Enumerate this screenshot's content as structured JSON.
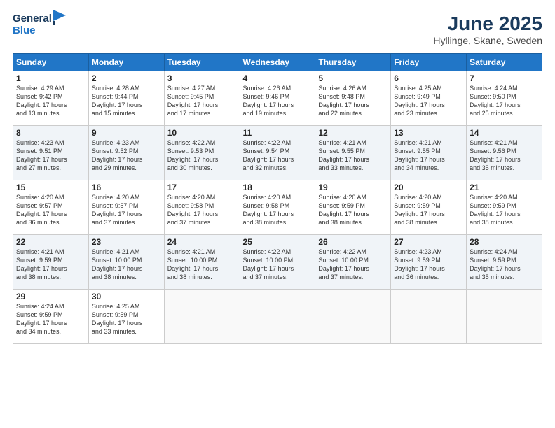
{
  "logo": {
    "general": "General",
    "blue": "Blue"
  },
  "title": "June 2025",
  "location": "Hyllinge, Skane, Sweden",
  "header_days": [
    "Sunday",
    "Monday",
    "Tuesday",
    "Wednesday",
    "Thursday",
    "Friday",
    "Saturday"
  ],
  "weeks": [
    [
      {
        "day": "1",
        "info": "Sunrise: 4:29 AM\nSunset: 9:42 PM\nDaylight: 17 hours\nand 13 minutes."
      },
      {
        "day": "2",
        "info": "Sunrise: 4:28 AM\nSunset: 9:44 PM\nDaylight: 17 hours\nand 15 minutes."
      },
      {
        "day": "3",
        "info": "Sunrise: 4:27 AM\nSunset: 9:45 PM\nDaylight: 17 hours\nand 17 minutes."
      },
      {
        "day": "4",
        "info": "Sunrise: 4:26 AM\nSunset: 9:46 PM\nDaylight: 17 hours\nand 19 minutes."
      },
      {
        "day": "5",
        "info": "Sunrise: 4:26 AM\nSunset: 9:48 PM\nDaylight: 17 hours\nand 22 minutes."
      },
      {
        "day": "6",
        "info": "Sunrise: 4:25 AM\nSunset: 9:49 PM\nDaylight: 17 hours\nand 23 minutes."
      },
      {
        "day": "7",
        "info": "Sunrise: 4:24 AM\nSunset: 9:50 PM\nDaylight: 17 hours\nand 25 minutes."
      }
    ],
    [
      {
        "day": "8",
        "info": "Sunrise: 4:23 AM\nSunset: 9:51 PM\nDaylight: 17 hours\nand 27 minutes."
      },
      {
        "day": "9",
        "info": "Sunrise: 4:23 AM\nSunset: 9:52 PM\nDaylight: 17 hours\nand 29 minutes."
      },
      {
        "day": "10",
        "info": "Sunrise: 4:22 AM\nSunset: 9:53 PM\nDaylight: 17 hours\nand 30 minutes."
      },
      {
        "day": "11",
        "info": "Sunrise: 4:22 AM\nSunset: 9:54 PM\nDaylight: 17 hours\nand 32 minutes."
      },
      {
        "day": "12",
        "info": "Sunrise: 4:21 AM\nSunset: 9:55 PM\nDaylight: 17 hours\nand 33 minutes."
      },
      {
        "day": "13",
        "info": "Sunrise: 4:21 AM\nSunset: 9:55 PM\nDaylight: 17 hours\nand 34 minutes."
      },
      {
        "day": "14",
        "info": "Sunrise: 4:21 AM\nSunset: 9:56 PM\nDaylight: 17 hours\nand 35 minutes."
      }
    ],
    [
      {
        "day": "15",
        "info": "Sunrise: 4:20 AM\nSunset: 9:57 PM\nDaylight: 17 hours\nand 36 minutes."
      },
      {
        "day": "16",
        "info": "Sunrise: 4:20 AM\nSunset: 9:57 PM\nDaylight: 17 hours\nand 37 minutes."
      },
      {
        "day": "17",
        "info": "Sunrise: 4:20 AM\nSunset: 9:58 PM\nDaylight: 17 hours\nand 37 minutes."
      },
      {
        "day": "18",
        "info": "Sunrise: 4:20 AM\nSunset: 9:58 PM\nDaylight: 17 hours\nand 38 minutes."
      },
      {
        "day": "19",
        "info": "Sunrise: 4:20 AM\nSunset: 9:59 PM\nDaylight: 17 hours\nand 38 minutes."
      },
      {
        "day": "20",
        "info": "Sunrise: 4:20 AM\nSunset: 9:59 PM\nDaylight: 17 hours\nand 38 minutes."
      },
      {
        "day": "21",
        "info": "Sunrise: 4:20 AM\nSunset: 9:59 PM\nDaylight: 17 hours\nand 38 minutes."
      }
    ],
    [
      {
        "day": "22",
        "info": "Sunrise: 4:21 AM\nSunset: 9:59 PM\nDaylight: 17 hours\nand 38 minutes."
      },
      {
        "day": "23",
        "info": "Sunrise: 4:21 AM\nSunset: 10:00 PM\nDaylight: 17 hours\nand 38 minutes."
      },
      {
        "day": "24",
        "info": "Sunrise: 4:21 AM\nSunset: 10:00 PM\nDaylight: 17 hours\nand 38 minutes."
      },
      {
        "day": "25",
        "info": "Sunrise: 4:22 AM\nSunset: 10:00 PM\nDaylight: 17 hours\nand 37 minutes."
      },
      {
        "day": "26",
        "info": "Sunrise: 4:22 AM\nSunset: 10:00 PM\nDaylight: 17 hours\nand 37 minutes."
      },
      {
        "day": "27",
        "info": "Sunrise: 4:23 AM\nSunset: 9:59 PM\nDaylight: 17 hours\nand 36 minutes."
      },
      {
        "day": "28",
        "info": "Sunrise: 4:24 AM\nSunset: 9:59 PM\nDaylight: 17 hours\nand 35 minutes."
      }
    ],
    [
      {
        "day": "29",
        "info": "Sunrise: 4:24 AM\nSunset: 9:59 PM\nDaylight: 17 hours\nand 34 minutes."
      },
      {
        "day": "30",
        "info": "Sunrise: 4:25 AM\nSunset: 9:59 PM\nDaylight: 17 hours\nand 33 minutes."
      },
      {
        "day": "",
        "info": ""
      },
      {
        "day": "",
        "info": ""
      },
      {
        "day": "",
        "info": ""
      },
      {
        "day": "",
        "info": ""
      },
      {
        "day": "",
        "info": ""
      }
    ]
  ]
}
